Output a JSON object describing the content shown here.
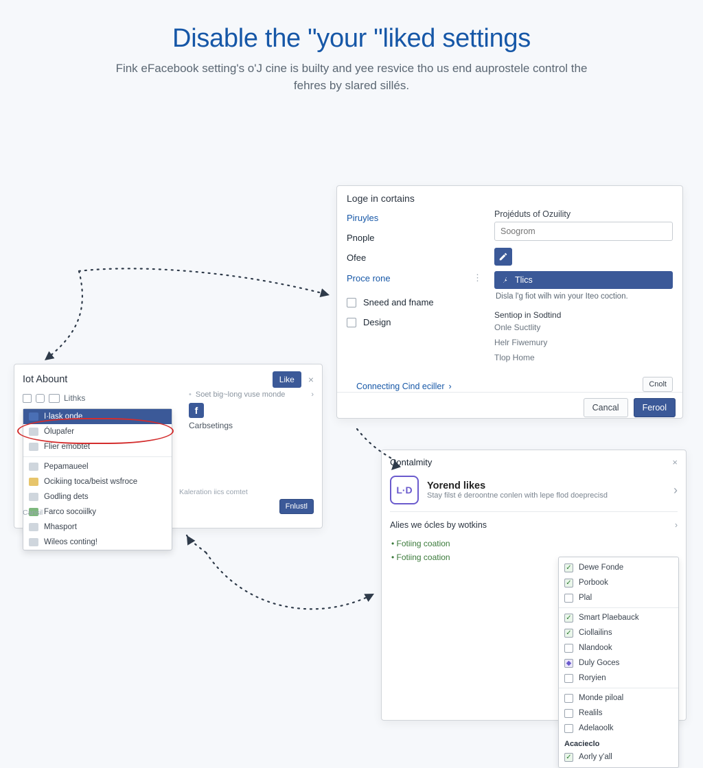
{
  "header": {
    "title": "Disable the \"your \"liked settings",
    "subtitle": "Fink eFacebook setting's o'J cine is builty and yee resvice tho us end auprostele control the fehres by slared sillés."
  },
  "panelA": {
    "title": "Loge in cortains",
    "nav": {
      "piruyles": "Piruyles",
      "pnople": "Pnople",
      "ofee": "Ofee",
      "proce_rone": "Proce rone",
      "sneed_and_fname": "Sneed and fname",
      "design": "Design"
    },
    "right": {
      "field_label": "Projéduts of Ozuility",
      "placeholder": "Soogrom",
      "tics_label": "Tlics",
      "tics_desc": "Disla l'g fiot wilh win your Iteo coction.",
      "sub_head": "Sentiop in Sodtind",
      "sub_items": [
        "Onle Suctlity",
        "Helr Fiwemury",
        "Tlop Home"
      ]
    },
    "footer": {
      "link": "Connecting Cind eciller",
      "cnolt": "Cnolt",
      "cancel": "Cancal",
      "proceed": "Ferool"
    }
  },
  "panelB": {
    "title": "Iot Abount",
    "like": "Like",
    "crumbs_label": "Lithks",
    "dropdown": [
      "I·lask onde",
      "Ólupafer",
      "Flier emobtet",
      "Pepamaueel",
      "Ocikiing toca/beist wsfroce",
      "Godling dets",
      "Farco socoiilky",
      "Mhasport",
      "Wileos conting!"
    ],
    "col2_hint": "Soet big~long vuse monde",
    "col2_label": "Carbsetings",
    "footnote": "Cansil",
    "footcaption": "Kaleration iics comtet",
    "enlist": "Fnlustl"
  },
  "panelC": {
    "title": "Contalmity",
    "hero_icon": "L·D",
    "hero_title": "Yorend likes",
    "hero_sub": "Stay filst é deroontne conlen with lepe flod doeprecisd",
    "row_label": "Alies we ócles by wotkins",
    "bullets": [
      "Fotiing coation",
      "Fotiing coation"
    ],
    "checklist_group1": [
      "Dewe Fonde",
      "Porbook",
      "Plal"
    ],
    "checklist_group2": [
      "Smart Plaebauck",
      "Ciollailins",
      "Nlandook",
      "Duly Goces",
      "Roryien"
    ],
    "checklist_group3_label": "",
    "checklist_group3": [
      "Monde piloal",
      "Realils",
      "Adelaoolk"
    ],
    "checklist_group4_label": "Acacieclo",
    "checklist_group4": [
      "Aorly y'all"
    ]
  }
}
